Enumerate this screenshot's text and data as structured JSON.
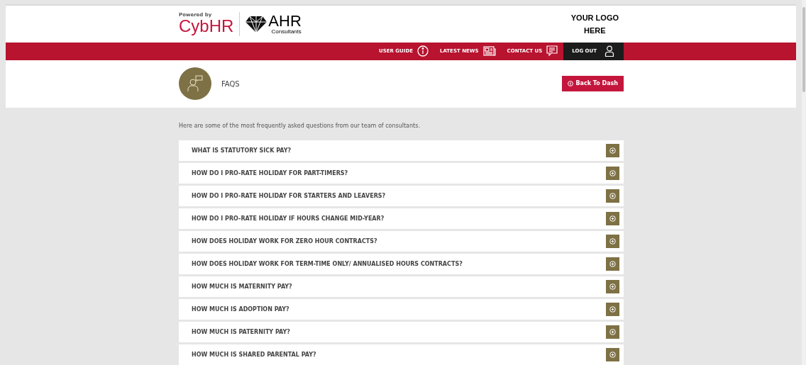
{
  "header": {
    "powered_by": "Powered by",
    "brand": "CybHR",
    "partner": "AHR",
    "partner_sub": "Consultants",
    "client_logo": [
      "YOUR LOGO",
      "HERE"
    ]
  },
  "nav": [
    {
      "label": "USER GUIDE",
      "kind": "info"
    },
    {
      "label": "LATEST NEWS",
      "kind": "news"
    },
    {
      "label": "CONTACT US",
      "kind": "chat"
    },
    {
      "label": "LOG OUT",
      "kind": "account"
    }
  ],
  "page": {
    "title": "FAQS",
    "back_button": "Back To Dash"
  },
  "intro": "Here are some of the most frequently asked questions from our team of consultants.",
  "faqs": [
    "WHAT IS STATUTORY SICK PAY?",
    "HOW DO I PRO-RATE HOLIDAY FOR PART-TIMERS?",
    "HOW DO I PRO-RATE HOLIDAY FOR STARTERS AND LEAVERS?",
    "HOW DO I PRO-RATE HOLIDAY IF HOURS CHANGE MID-YEAR?",
    "HOW DOES HOLIDAY WORK FOR ZERO HOUR CONTRACTS?",
    "HOW DOES HOLIDAY WORK FOR TERM-TIME ONLY/ ANNUALISED HOURS CONTRACTS?",
    "HOW MUCH IS MATERNITY PAY?",
    "HOW MUCH IS ADOPTION PAY?",
    "HOW MUCH IS PATERNITY PAY?",
    "HOW MUCH IS SHARED PARENTAL PAY?"
  ]
}
